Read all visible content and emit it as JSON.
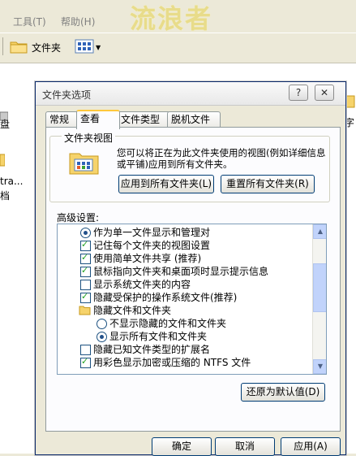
{
  "explorer": {
    "menu_tools": "工具(T)",
    "menu_help": "帮助(H)",
    "watermark": "流浪者",
    "folders_btn": "文件夹",
    "left_items": [
      "盘",
      "",
      "tra...",
      "档"
    ],
    "right_item": "字"
  },
  "dialog": {
    "title": "文件夹选项",
    "help_btn": "?",
    "close_btn": "✕",
    "tabs": [
      "常规",
      "查看",
      "文件类型",
      "脱机文件"
    ],
    "folder_views_label": "文件夹视图",
    "folder_views_desc": "您可以将正在为此文件夹使用的视图(例如详细信息或平铺)应用到所有文件夹。",
    "apply_all": "应用到所有文件夹(L)",
    "reset_all": "重置所有文件夹(R)",
    "advanced_label": "高级设置:",
    "tree_rows": [
      {
        "kind": "radio",
        "checked": true,
        "indent": 1,
        "label": "作为单一文件显示和管理对"
      },
      {
        "kind": "check",
        "checked": true,
        "indent": 0,
        "label": "记住每个文件夹的视图设置"
      },
      {
        "kind": "check",
        "checked": true,
        "indent": 0,
        "label": "使用简单文件共享 (推荐)"
      },
      {
        "kind": "check",
        "checked": true,
        "indent": 0,
        "label": "鼠标指向文件夹和桌面项时显示提示信息"
      },
      {
        "kind": "check",
        "checked": false,
        "indent": 0,
        "label": "显示系统文件夹的内容"
      },
      {
        "kind": "check",
        "checked": true,
        "indent": 0,
        "label": "隐藏受保护的操作系统文件(推荐)"
      },
      {
        "kind": "folder",
        "checked": false,
        "indent": 0,
        "label": "隐藏文件和文件夹"
      },
      {
        "kind": "radio",
        "checked": false,
        "indent": 1,
        "label": "不显示隐藏的文件和文件夹"
      },
      {
        "kind": "radio",
        "checked": true,
        "indent": 1,
        "label": "显示所有文件和文件夹"
      },
      {
        "kind": "check",
        "checked": false,
        "indent": 0,
        "label": "隐藏已知文件类型的扩展名"
      },
      {
        "kind": "check",
        "checked": true,
        "indent": 0,
        "label": "用彩色显示加密或压缩的 NTFS 文件"
      }
    ],
    "restore_defaults": "还原为默认值(D)",
    "ok": "确定",
    "cancel": "取消",
    "apply": "应用(A)"
  }
}
